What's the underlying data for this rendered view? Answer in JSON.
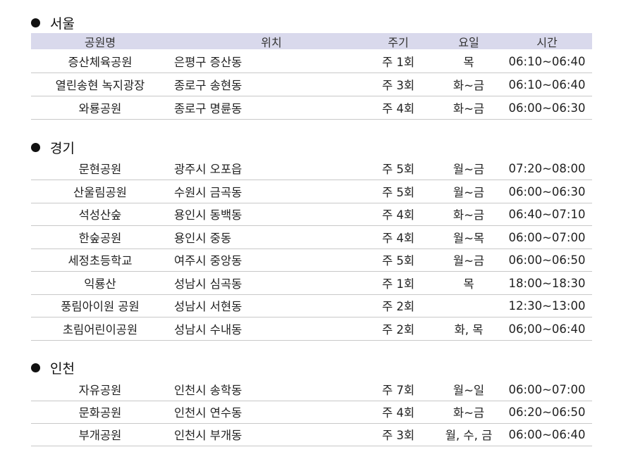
{
  "header": {
    "park": "공원명",
    "location": "위치",
    "cycle": "주기",
    "day": "요일",
    "time": "시간"
  },
  "regions": [
    {
      "name": "서울",
      "rows": [
        {
          "park": "증산체육공원",
          "location": "은평구 증산동",
          "cycle": "주 1회",
          "day": "목",
          "time": "06:10~06:40"
        },
        {
          "park": "열린송현 녹지광장",
          "location": "종로구 송현동",
          "cycle": "주 3회",
          "day": "화~금",
          "time": "06:10~06:40"
        },
        {
          "park": "와룡공원",
          "location": "종로구 명륜동",
          "cycle": "주 4회",
          "day": "화~금",
          "time": "06:00~06:30"
        }
      ]
    },
    {
      "name": "경기",
      "rows": [
        {
          "park": "문현공원",
          "location": "광주시 오포읍",
          "cycle": "주 5회",
          "day": "월~금",
          "time": "07:20~08:00"
        },
        {
          "park": "산울림공원",
          "location": "수원시 금곡동",
          "cycle": "주 5회",
          "day": "월~금",
          "time": "06:00~06:30"
        },
        {
          "park": "석성산숲",
          "location": "용인시 동백동",
          "cycle": "주 4회",
          "day": "화~금",
          "time": "06:40~07:10"
        },
        {
          "park": "한숲공원",
          "location": "용인시 중동",
          "cycle": "주 4회",
          "day": "월~목",
          "time": "06:00~07:00"
        },
        {
          "park": "세정초등학교",
          "location": "여주시 중앙동",
          "cycle": "주 5회",
          "day": "월~금",
          "time": "06:00~06:50"
        },
        {
          "park": "익룡산",
          "location": "성남시 심곡동",
          "cycle": "주 1회",
          "day": "목",
          "time": "18:00~18:30"
        },
        {
          "park": "풍림아이원 공원",
          "location": "성남시 서현동",
          "cycle": "주 2회",
          "day": "",
          "time": "12:30~13:00"
        },
        {
          "park": "초림어린이공원",
          "location": "성남시 수내동",
          "cycle": "주 2회",
          "day": "화, 목",
          "time": "06;00~06:40"
        }
      ]
    },
    {
      "name": "인천",
      "rows": [
        {
          "park": "자유공원",
          "location": "인천시 송학동",
          "cycle": "주 7회",
          "day": "월~일",
          "time": "06:00~07:00"
        },
        {
          "park": "문화공원",
          "location": "인천시 연수동",
          "cycle": "주 4회",
          "day": "화~금",
          "time": "06:20~06:50"
        },
        {
          "park": "부개공원",
          "location": "인천시 부개동",
          "cycle": "주 3회",
          "day": "월, 수, 금",
          "time": "06:00~06:40"
        }
      ]
    }
  ]
}
